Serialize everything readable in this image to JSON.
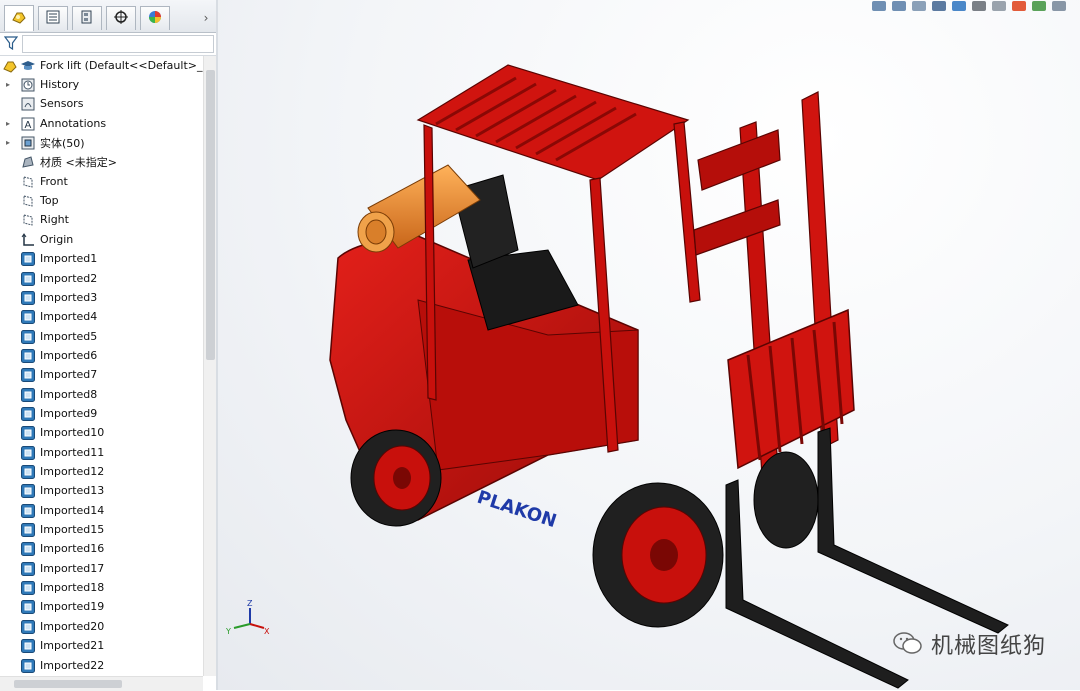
{
  "feature_tree": {
    "tabs": [
      {
        "id": "feature-manager",
        "icon": "feature-manager-icon"
      },
      {
        "id": "property-manager",
        "icon": "property-manager-icon"
      },
      {
        "id": "configuration-manager",
        "icon": "configuration-manager-icon"
      },
      {
        "id": "dimxpert",
        "icon": "dimxpert-target-icon"
      },
      {
        "id": "display-manager",
        "icon": "display-manager-pie-icon"
      }
    ],
    "more_glyph": "›",
    "root": {
      "label": "Fork lift  (Default<<Default>_Ph"
    },
    "items": [
      {
        "label": "History",
        "icon": "history-icon",
        "expandable": true
      },
      {
        "label": "Sensors",
        "icon": "sensors-icon",
        "expandable": false
      },
      {
        "label": "Annotations",
        "icon": "annotations-icon",
        "expandable": true
      },
      {
        "label": "实体(50)",
        "icon": "solid-bodies-folder-icon",
        "expandable": true
      },
      {
        "label": "材质 <未指定>",
        "icon": "material-icon",
        "expandable": false
      },
      {
        "label": "Front",
        "icon": "plane-icon",
        "expandable": false
      },
      {
        "label": "Top",
        "icon": "plane-icon",
        "expandable": false
      },
      {
        "label": "Right",
        "icon": "plane-icon",
        "expandable": false
      },
      {
        "label": "Origin",
        "icon": "origin-icon",
        "expandable": false
      },
      {
        "label": "Imported1",
        "icon": "imported-feature-icon"
      },
      {
        "label": "Imported2",
        "icon": "imported-feature-icon"
      },
      {
        "label": "Imported3",
        "icon": "imported-feature-icon"
      },
      {
        "label": "Imported4",
        "icon": "imported-feature-icon"
      },
      {
        "label": "Imported5",
        "icon": "imported-feature-icon"
      },
      {
        "label": "Imported6",
        "icon": "imported-feature-icon"
      },
      {
        "label": "Imported7",
        "icon": "imported-feature-icon"
      },
      {
        "label": "Imported8",
        "icon": "imported-feature-icon"
      },
      {
        "label": "Imported9",
        "icon": "imported-feature-icon"
      },
      {
        "label": "Imported10",
        "icon": "imported-feature-icon"
      },
      {
        "label": "Imported11",
        "icon": "imported-feature-icon"
      },
      {
        "label": "Imported12",
        "icon": "imported-feature-icon"
      },
      {
        "label": "Imported13",
        "icon": "imported-feature-icon"
      },
      {
        "label": "Imported14",
        "icon": "imported-feature-icon"
      },
      {
        "label": "Imported15",
        "icon": "imported-feature-icon"
      },
      {
        "label": "Imported16",
        "icon": "imported-feature-icon"
      },
      {
        "label": "Imported17",
        "icon": "imported-feature-icon"
      },
      {
        "label": "Imported18",
        "icon": "imported-feature-icon"
      },
      {
        "label": "Imported19",
        "icon": "imported-feature-icon"
      },
      {
        "label": "Imported20",
        "icon": "imported-feature-icon"
      },
      {
        "label": "Imported21",
        "icon": "imported-feature-icon"
      },
      {
        "label": "Imported22",
        "icon": "imported-feature-icon"
      }
    ]
  },
  "viewport": {
    "model_decal": "PLAKON",
    "triad": {
      "x": "X",
      "y": "Y",
      "z": "Z"
    },
    "colors": {
      "body": "#c8100c",
      "accent": "#e01a14",
      "tank": "#f08a2a",
      "tire": "#202020",
      "fork": "#1e1e1e",
      "decal": "#1f3aa8"
    }
  },
  "watermark": {
    "text": "机械图纸狗"
  }
}
